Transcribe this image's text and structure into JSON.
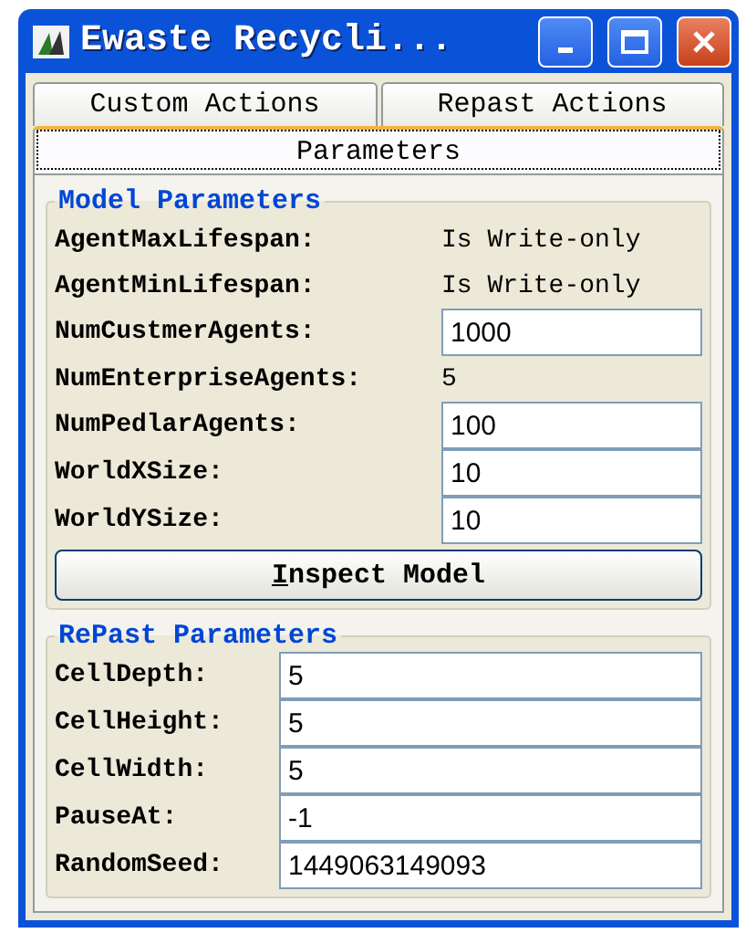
{
  "window": {
    "title": "Ewaste Recycli..."
  },
  "tabs": [
    {
      "label": "Custom Actions",
      "selected": false
    },
    {
      "label": "Repast Actions",
      "selected": false
    },
    {
      "label": "Parameters",
      "selected": true
    }
  ],
  "model_parameters": {
    "title": "Model Parameters",
    "rows": [
      {
        "kind": "readonly",
        "label": "AgentMaxLifespan:",
        "value": "Is Write-only"
      },
      {
        "kind": "readonly",
        "label": "AgentMinLifespan:",
        "value": "Is Write-only"
      },
      {
        "kind": "input",
        "label": "NumCustmerAgents:",
        "value": "1000"
      },
      {
        "kind": "readonly",
        "label": "NumEnterpriseAgents:",
        "value": "5"
      },
      {
        "kind": "input",
        "label": "NumPedlarAgents:",
        "value": "100"
      },
      {
        "kind": "input",
        "label": "WorldXSize:",
        "value": "10"
      },
      {
        "kind": "input",
        "label": "WorldYSize:",
        "value": "10"
      }
    ],
    "button": {
      "label": "Inspect Model",
      "mnemonic_underlined": true
    }
  },
  "repast_parameters": {
    "title": "RePast Parameters",
    "rows": [
      {
        "kind": "input",
        "label": "CellDepth:",
        "value": "5"
      },
      {
        "kind": "input",
        "label": "CellHeight:",
        "value": "5"
      },
      {
        "kind": "input",
        "label": "CellWidth:",
        "value": "5"
      },
      {
        "kind": "input",
        "label": "PauseAt:",
        "value": "-1"
      },
      {
        "kind": "input",
        "label": "RandomSeed:",
        "value": "1449063149093"
      }
    ]
  }
}
